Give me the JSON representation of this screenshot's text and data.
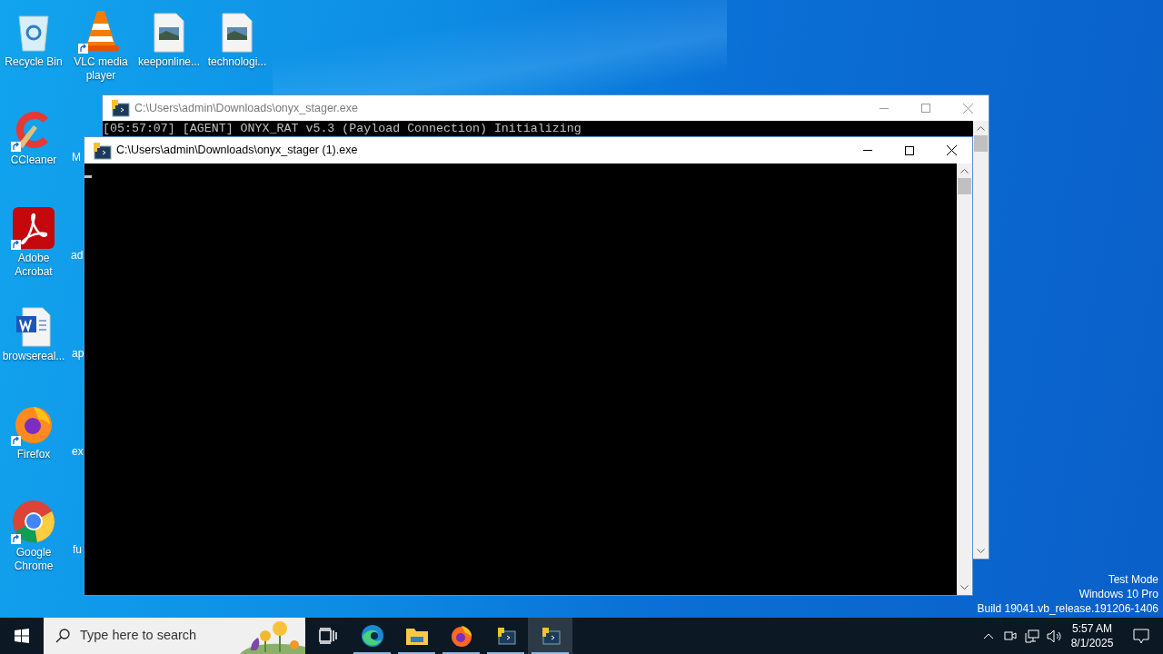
{
  "desktop_icons": [
    {
      "label": "Recycle Bin",
      "kind": "recycle-bin",
      "shortcut": false
    },
    {
      "label": "VLC media player",
      "kind": "vlc",
      "shortcut": true
    },
    {
      "label": "keeponline...",
      "kind": "image-file",
      "shortcut": false
    },
    {
      "label": "technologi...",
      "kind": "image-file",
      "shortcut": false
    },
    {
      "label": "CCleaner",
      "kind": "ccleaner",
      "shortcut": true
    },
    {
      "label": "Adobe Acrobat",
      "kind": "acrobat",
      "shortcut": true
    },
    {
      "label": "browsereal...",
      "kind": "word-file",
      "shortcut": false
    },
    {
      "label": "Firefox",
      "kind": "firefox",
      "shortcut": true
    },
    {
      "label": "Google Chrome",
      "kind": "chrome",
      "shortcut": true
    }
  ],
  "covered_labels": [
    "M",
    "ad",
    "ap",
    "ex",
    "fu"
  ],
  "windows": [
    {
      "title": "C:\\Users\\admin\\Downloads\\onyx_stager.exe",
      "active": false,
      "lines": [
        "[05:57:07] [AGENT] ONYX_RAT v5.3 (Payload Connection) Initializing"
      ]
    },
    {
      "title": "C:\\Users\\admin\\Downloads\\onyx_stager (1).exe",
      "active": true,
      "cursor": true
    }
  ],
  "taskbar": {
    "search": {
      "placeholder": "Type here to search"
    },
    "apps": [
      {
        "kind": "task-view",
        "running": false,
        "selected": false
      },
      {
        "kind": "edge",
        "running": true,
        "selected": false
      },
      {
        "kind": "explorer",
        "running": true,
        "selected": false
      },
      {
        "kind": "firefox",
        "running": true,
        "selected": false
      },
      {
        "kind": "console",
        "running": true,
        "selected": false
      },
      {
        "kind": "console",
        "running": true,
        "selected": true
      }
    ],
    "clock": {
      "time": "5:57 AM",
      "date": "8/1/2025"
    }
  },
  "edition": [
    "Test Mode",
    "Windows 10 Pro",
    "Build 19041.vb_release.191206-1406"
  ]
}
